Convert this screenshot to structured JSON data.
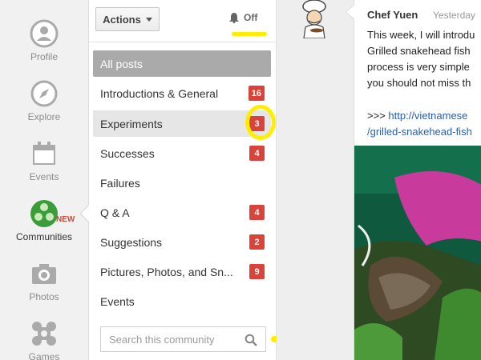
{
  "nav": {
    "items": [
      {
        "label": "Profile",
        "icon": "profile-icon"
      },
      {
        "label": "Explore",
        "icon": "compass-icon"
      },
      {
        "label": "Events",
        "icon": "calendar-icon"
      },
      {
        "label": "Communities",
        "icon": "communities-icon",
        "badge": "NEW",
        "active": true
      },
      {
        "label": "Photos",
        "icon": "camera-icon"
      },
      {
        "label": "Games",
        "icon": "games-icon"
      }
    ]
  },
  "sidebar": {
    "actions_label": "Actions",
    "notifications_label": "Off",
    "categories": [
      {
        "label": "All posts",
        "count": null
      },
      {
        "label": "Introductions & General",
        "count": "16"
      },
      {
        "label": "Experiments",
        "count": "3"
      },
      {
        "label": "Successes",
        "count": "4"
      },
      {
        "label": "Failures",
        "count": null
      },
      {
        "label": "Q & A",
        "count": "4"
      },
      {
        "label": "Suggestions",
        "count": "2"
      },
      {
        "label": "Pictures, Photos, and Sn...",
        "count": "9"
      },
      {
        "label": "Events",
        "count": null
      }
    ],
    "search": {
      "placeholder": "Search this community"
    }
  },
  "post": {
    "author": "Chef Yuen",
    "time": "Yesterday",
    "lines": [
      "This week, I will introdu",
      "Grilled snakehead fish",
      "process is very simple",
      "you should not miss th"
    ],
    "link_prefix": ">>>",
    "link_line1": "http://vietnamese",
    "link_line2": "/grilled-snakehead-fish"
  },
  "colors": {
    "badge": "#d9443a",
    "highlight": "#ffee00",
    "link": "#2a5db0",
    "communities_green": "#3b9c3b"
  }
}
